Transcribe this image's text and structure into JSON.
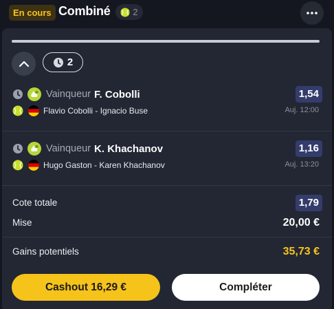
{
  "header": {
    "status_badge": "En cours",
    "title": "Combiné",
    "selection_count": "2",
    "more_icon": "more-horizontal-icon"
  },
  "summary_controls": {
    "collapse_icon": "chevron-up-icon",
    "live_count": "2"
  },
  "selections": [
    {
      "market": "Vainqueur",
      "pick": "F. Cobolli",
      "odds": "1,54",
      "match": "Flavio Cobolli - Ignacio Buse",
      "time": "Auj. 12:00",
      "sport_icon": "tennis-ball-icon",
      "flag": "germany-flag"
    },
    {
      "market": "Vainqueur",
      "pick": "K. Khachanov",
      "odds": "1,16",
      "match": "Hugo Gaston - Karen Khachanov",
      "time": "Auj. 13:20",
      "sport_icon": "tennis-ball-icon",
      "flag": "germany-flag"
    }
  ],
  "summary": {
    "total_odds_label": "Cote totale",
    "total_odds": "1,79",
    "stake_label": "Mise",
    "stake": "20,00 €",
    "gains_label": "Gains potentiels",
    "gains": "35,73 €"
  },
  "actions": {
    "cashout_label": "Cashout 16,29 €",
    "complete_label": "Compléter"
  },
  "colors": {
    "background": "#14171f",
    "card": "#232733",
    "accent_yellow": "#f7c51e",
    "odds_badge": "#343c6c"
  }
}
